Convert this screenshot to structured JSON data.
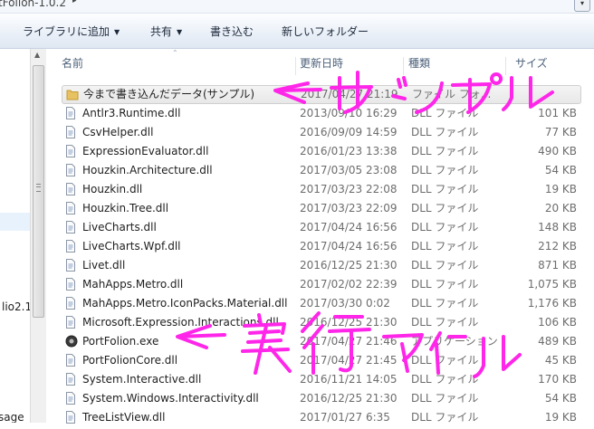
{
  "window": {
    "path": "tFolion-1.0.2",
    "path_arrow": "▸",
    "ctrl": "▾"
  },
  "toolbar": {
    "library": "ライブラリに追加",
    "share": "共有",
    "burn": "書き込む",
    "new_folder": "新しいフォルダー"
  },
  "headers": {
    "name": "名前",
    "date": "更新日時",
    "type": "種類",
    "size": "サイズ"
  },
  "left_pane": {
    "item1": "lio2.1",
    "item2": "sage"
  },
  "files": [
    {
      "name": "今まで書き込んだデータ(サンプル)",
      "date": "2017/04/27 21:19",
      "type": "ファイル フォ...",
      "size": "",
      "icon": "folder-icon"
    },
    {
      "name": "Antlr3.Runtime.dll",
      "date": "2013/09/10 16:29",
      "type": "DLL ファイル",
      "size": "101 KB",
      "icon": "dll-file-icon"
    },
    {
      "name": "CsvHelper.dll",
      "date": "2016/09/09 14:59",
      "type": "DLL ファイル",
      "size": "77 KB",
      "icon": "dll-file-icon"
    },
    {
      "name": "ExpressionEvaluator.dll",
      "date": "2016/01/23 13:38",
      "type": "DLL ファイル",
      "size": "490 KB",
      "icon": "dll-file-icon"
    },
    {
      "name": "Houzkin.Architecture.dll",
      "date": "2017/03/05 23:08",
      "type": "DLL ファイル",
      "size": "54 KB",
      "icon": "dll-file-icon"
    },
    {
      "name": "Houzkin.dll",
      "date": "2017/03/23 22:08",
      "type": "DLL ファイル",
      "size": "19 KB",
      "icon": "dll-file-icon"
    },
    {
      "name": "Houzkin.Tree.dll",
      "date": "2017/03/23 22:09",
      "type": "DLL ファイル",
      "size": "20 KB",
      "icon": "dll-file-icon"
    },
    {
      "name": "LiveCharts.dll",
      "date": "2017/04/24 16:56",
      "type": "DLL ファイル",
      "size": "148 KB",
      "icon": "dll-file-icon"
    },
    {
      "name": "LiveCharts.Wpf.dll",
      "date": "2017/04/24 16:56",
      "type": "DLL ファイル",
      "size": "212 KB",
      "icon": "dll-file-icon"
    },
    {
      "name": "Livet.dll",
      "date": "2016/12/25 21:30",
      "type": "DLL ファイル",
      "size": "871 KB",
      "icon": "dll-file-icon"
    },
    {
      "name": "MahApps.Metro.dll",
      "date": "2017/02/02 22:39",
      "type": "DLL ファイル",
      "size": "1,075 KB",
      "icon": "dll-file-icon"
    },
    {
      "name": "MahApps.Metro.IconPacks.Material.dll",
      "date": "2017/03/30 0:02",
      "type": "DLL ファイル",
      "size": "1,176 KB",
      "icon": "dll-file-icon"
    },
    {
      "name": "Microsoft.Expression.Interactions.dll",
      "date": "2016/12/25 21:30",
      "type": "DLL ファイル",
      "size": "106 KB",
      "icon": "dll-file-icon"
    },
    {
      "name": "PortFolion.exe",
      "date": "2017/04/27 21:46",
      "type": "アプリケーション",
      "size": "489 KB",
      "icon": "app-gear-icon"
    },
    {
      "name": "PortFolionCore.dll",
      "date": "2017/04/27 21:45",
      "type": "DLL ファイル",
      "size": "45 KB",
      "icon": "dll-file-icon"
    },
    {
      "name": "System.Interactive.dll",
      "date": "2016/11/21 14:05",
      "type": "DLL ファイル",
      "size": "170 KB",
      "icon": "dll-file-icon"
    },
    {
      "name": "System.Windows.Interactivity.dll",
      "date": "2016/12/25 21:30",
      "type": "DLL ファイル",
      "size": "54 KB",
      "icon": "dll-file-icon"
    },
    {
      "name": "TreeListView.dll",
      "date": "2017/01/27 6:35",
      "type": "DLL ファイル",
      "size": "19 KB",
      "icon": "dll-file-icon"
    }
  ],
  "annotations": {
    "sample": "←サンプル",
    "exe": "←実行ファイル",
    "color": "#ff26e9"
  },
  "colors": {
    "toolbar_text": "#1e2a3c",
    "header_text": "#4c607a",
    "meta_text": "#6d6d6d"
  }
}
